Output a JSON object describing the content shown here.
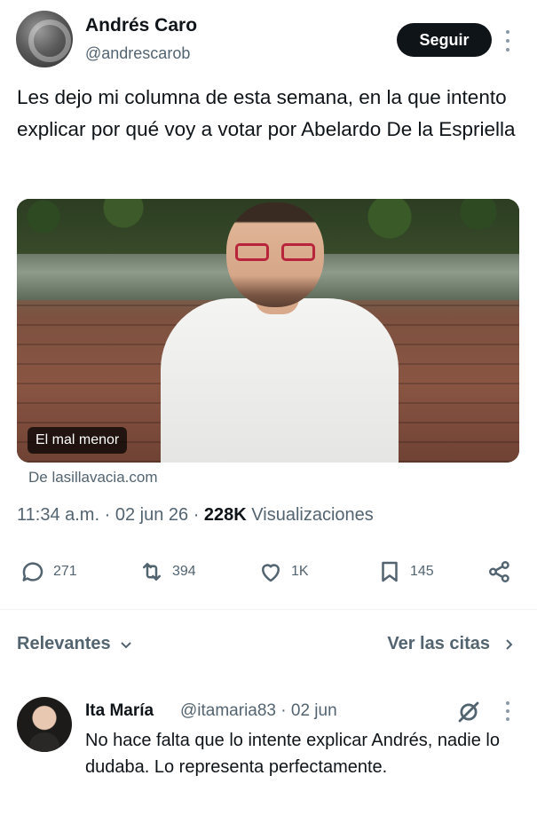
{
  "author": {
    "name": "Andrés Caro",
    "handle": "@andrescarob",
    "follow_label": "Seguir"
  },
  "tweet": {
    "text": "Les dejo mi columna de esta semana, en la que intento explicar por qué voy a votar por Abelardo De la Espriella",
    "card": {
      "tag": "El mal menor",
      "source": "De lasillavacia.com"
    },
    "meta": {
      "time": "11:34 a.m.",
      "date": "02 jun 26",
      "views_count": "228K",
      "views_label": "Visualizaciones",
      "separator": "·"
    }
  },
  "actions": {
    "replies": "271",
    "reposts": "394",
    "likes": "1K",
    "bookmarks": "145",
    "icons": [
      "reply-icon",
      "repost-icon",
      "like-icon",
      "bookmark-icon",
      "share-icon"
    ]
  },
  "replies_bar": {
    "sort_label": "Relevantes",
    "quotes_label": "Ver las citas"
  },
  "reply": {
    "name": "Ita María",
    "handle_date": "@itamaria83 · 02 jun",
    "text": "No hace falta que lo intente explicar Andrés, nadie lo dudaba. Lo representa perfectamente."
  },
  "colors": {
    "text_primary": "#0f1419",
    "text_secondary": "#536471",
    "follow_bg": "#0f1419"
  }
}
